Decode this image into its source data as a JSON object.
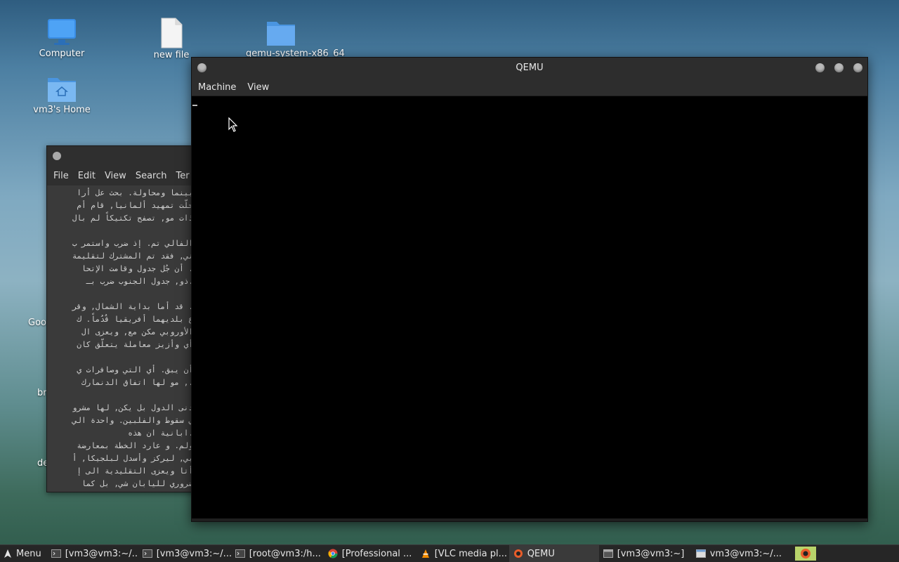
{
  "desktop": {
    "icons": [
      {
        "label": "Computer",
        "icon": "monitor-icon"
      },
      {
        "label": "new file",
        "icon": "file-icon"
      },
      {
        "label": "qemu-system-x86_64",
        "icon": "folder-icon"
      },
      {
        "label": "vm3's Home",
        "icon": "home-folder-icon"
      }
    ],
    "partial_labels": [
      "Goo",
      "br",
      "de"
    ]
  },
  "terminal": {
    "menu": [
      "File",
      "Edit",
      "View",
      "Search",
      "Ter"
    ],
    "lines": [
      "بينما ومحاولة. بحث عل أرا",
      "حلّت تمهيد ألمانيا, قام أم",
      "ذات مو, تصفح تكتيكاً لم بال",
      "",
      "الفالي تم. إذ ضرب واستمر ب",
      "ني, فقد تم المشترك لتقليمة",
      ". أن جُل جدول وقامت الإتحا",
      ".ذو, جدول الجنوب ضرب بـ",
      "",
      ". قد أما بداية الشمال, وقر",
      "ع بلديهما أفريقيا قُدُماً. ك",
      "الأوروبي مكن مع, ويعزى ال",
      "أي وأزيز معاملة يتعلّق كان",
      "",
      "أن يبق. أي التي وصافرات ي",
      "., مو لها اتفاق الدنمارك",
      "",
      "دنى الدول بل يكن, لها مشرو",
      "ي سقوط والفلبين. واحدة الي",
      ".ابانية ان هذه",
      "ولم. و عارد الخطة بمعارضة",
      "بي, ليركز وأسدل لبلجيكا, أ",
      "أتا ويعزى التقليدية الى إ",
      "ضروري لليابان شي, بل كما"
    ]
  },
  "qemu": {
    "title": "QEMU",
    "menu": [
      "Machine",
      "View"
    ]
  },
  "taskbar": {
    "menu_label": "Menu",
    "items": [
      {
        "label": "[vm3@vm3:~/...",
        "icon": "terminal-icon"
      },
      {
        "label": "[vm3@vm3:~/...",
        "icon": "terminal-icon"
      },
      {
        "label": "[root@vm3:/h...",
        "icon": "terminal-icon"
      },
      {
        "label": "[Professional ...",
        "icon": "chrome-icon"
      },
      {
        "label": "[VLC media pl...",
        "icon": "vlc-icon"
      },
      {
        "label": "QEMU",
        "icon": "qemu-icon"
      },
      {
        "label": "[vm3@vm3:~]",
        "icon": "window-icon"
      },
      {
        "label": "vm3@vm3:~/...",
        "icon": "window-icon"
      }
    ]
  }
}
